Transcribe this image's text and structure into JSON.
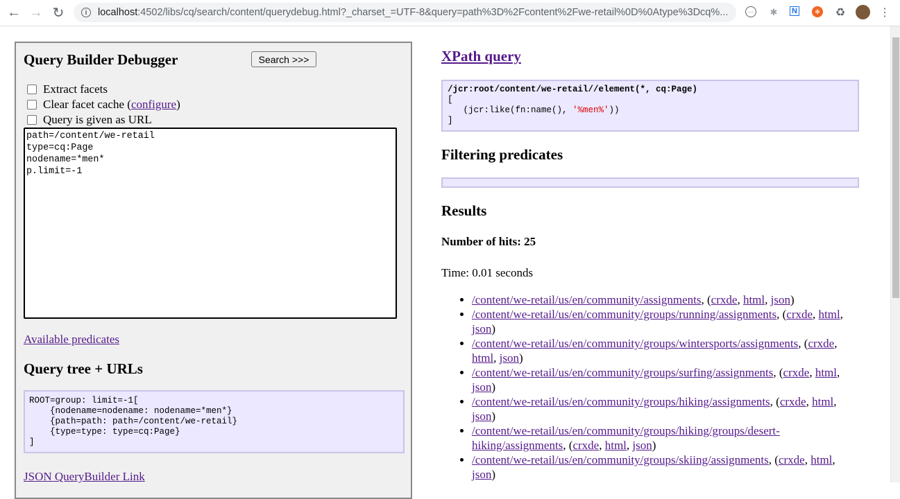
{
  "browser": {
    "url_host": "localhost",
    "url_rest": ":4502/libs/cq/search/content/querydebug.html?_charset_=UTF-8&query=path%3D%2Fcontent%2Fwe-retail%0D%0Atype%3Dcq%..."
  },
  "debugger": {
    "title": "Query Builder Debugger",
    "search_button": "Search >>>",
    "checkboxes": {
      "extract_facets": "Extract facets",
      "clear_cache_prefix": "Clear facet cache (",
      "clear_cache_link": "configure",
      "clear_cache_suffix": ")",
      "query_as_url": "Query is given as URL"
    },
    "query_text": "path=/content/we-retail\ntype=cq:Page\nnodename=*men*\np.limit=-1",
    "available_predicates": "Available predicates",
    "tree_heading": "Query tree + URLs",
    "tree_text": "ROOT=group: limit=-1[\n    {nodename=nodename: nodename=*men*}\n    {path=path: path=/content/we-retail}\n    {type=type: type=cq:Page}\n]",
    "json_link": "JSON QueryBuilder Link"
  },
  "xpath": {
    "heading": "XPath query",
    "line1": "/jcr:root/content/we-retail//element(*, cq:Page)",
    "line2": "[",
    "line3_pre": "   (jcr:like(fn:name(), ",
    "line3_str": "'%men%'",
    "line3_post": "))",
    "line4": "]"
  },
  "filtering": {
    "heading": "Filtering predicates"
  },
  "results": {
    "heading": "Results",
    "hits": "Number of hits: 25",
    "time": "Time: 0.01 seconds",
    "items": [
      {
        "path": "/content/we-retail/us/en/community/assignments"
      },
      {
        "path": "/content/we-retail/us/en/community/groups/running/assignments"
      },
      {
        "path": "/content/we-retail/us/en/community/groups/wintersports/assignments"
      },
      {
        "path": "/content/we-retail/us/en/community/groups/surfing/assignments"
      },
      {
        "path": "/content/we-retail/us/en/community/groups/hiking/assignments"
      },
      {
        "path": "/content/we-retail/us/en/community/groups/hiking/groups/desert-hiking/assignments"
      },
      {
        "path": "/content/we-retail/us/en/community/groups/skiing/assignments"
      }
    ],
    "link_labels": {
      "crxde": "crxde",
      "html": "html",
      "json": "json"
    }
  }
}
